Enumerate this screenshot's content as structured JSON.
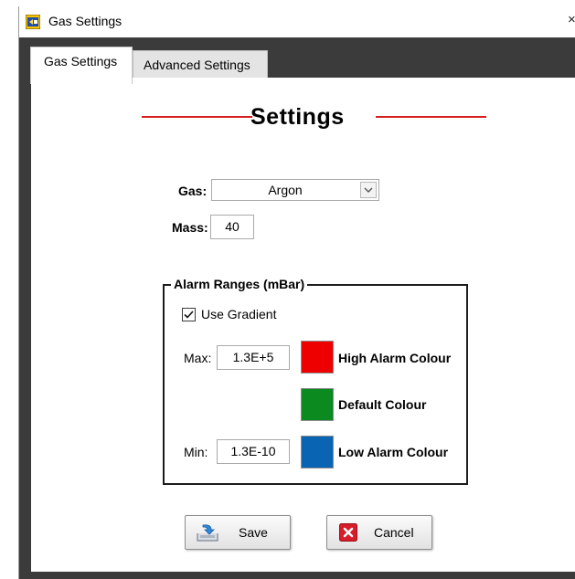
{
  "window": {
    "title": "Gas Settings",
    "close_glyph": "×",
    "app_icon": "labview-app-icon"
  },
  "tabs": [
    {
      "label": "Gas Settings",
      "active": true
    },
    {
      "label": "Advanced Settings",
      "active": false
    }
  ],
  "heading": "Settings",
  "gas": {
    "label": "Gas:",
    "value": "Argon"
  },
  "mass": {
    "label": "Mass:",
    "value": "40"
  },
  "alarm": {
    "title": "Alarm Ranges (mBar)",
    "use_gradient": {
      "label": "Use Gradient",
      "checked": true
    },
    "max": {
      "label": "Max:",
      "value": "1.3E+5"
    },
    "min": {
      "label": "Min:",
      "value": "1.3E-10"
    },
    "colours": [
      {
        "label": "High Alarm Colour",
        "color": "#ee0000"
      },
      {
        "label": "Default Colour",
        "color": "#0b8a1f"
      },
      {
        "label": "Low Alarm Colour",
        "color": "#0a64b4"
      }
    ]
  },
  "buttons": {
    "save": "Save",
    "cancel": "Cancel"
  },
  "colors": {
    "accent_line": "#d52020",
    "frame": "#3b3b3b"
  }
}
